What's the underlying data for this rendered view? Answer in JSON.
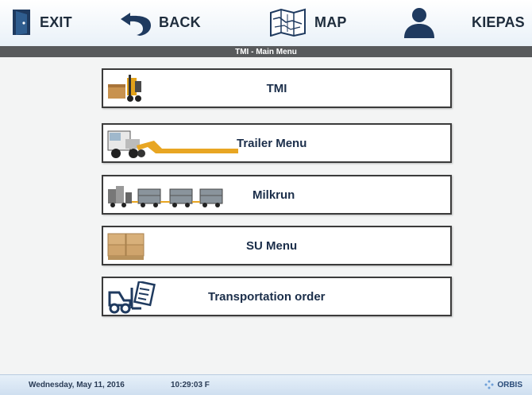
{
  "toolbar": {
    "exit_label": "EXIT",
    "back_label": "BACK",
    "map_label": "MAP",
    "user_label": "KIEPAS",
    "icons": {
      "exit": "door-exit-icon",
      "back": "undo-arrow-icon",
      "map": "map-icon",
      "user": "user-icon"
    }
  },
  "title": "TMI - Main Menu",
  "menu": {
    "items": [
      {
        "label": "TMI",
        "icon": "forklift-icon"
      },
      {
        "label": "Trailer Menu",
        "icon": "truck-trailer-icon"
      },
      {
        "label": "Milkrun",
        "icon": "milkrun-train-icon"
      },
      {
        "label": "SU Menu",
        "icon": "pallet-boxes-icon"
      },
      {
        "label": "Transportation order",
        "icon": "forklift-order-icon"
      }
    ]
  },
  "status": {
    "date": "Wednesday, May 11, 2016",
    "time": "10:29:03 F",
    "brand": "ORBIS"
  },
  "colors": {
    "title_bar": "#585a5c",
    "label_text": "#1b2e4a",
    "toolbar_icon": "#1f3a5f"
  }
}
